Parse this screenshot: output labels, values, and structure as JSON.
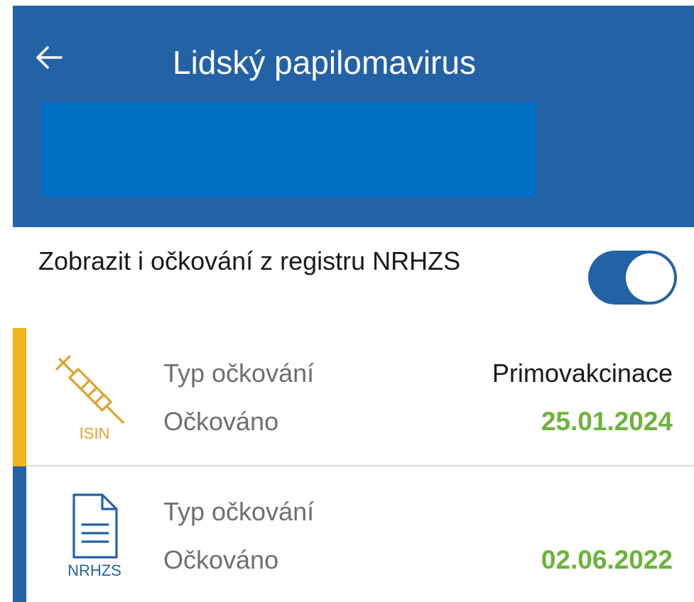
{
  "header": {
    "title": "Lidský papilomavirus",
    "back_icon": "arrow-left-icon",
    "background": "#2462a6",
    "redaction_color": "#0070c4"
  },
  "registry_toggle": {
    "label": "Zobrazit i očkování z registru NRHZS",
    "enabled": true,
    "color": "#2462a6"
  },
  "records": [
    {
      "source": "ISIN",
      "source_icon": "syringe-icon",
      "accent": "#f0b41f",
      "type_label": "Typ očkování",
      "type_value": "Primovakcinace",
      "date_label": "Očkováno",
      "date_value": "25.01.2024"
    },
    {
      "source": "NRHZS",
      "source_icon": "document-icon",
      "accent": "#2462a6",
      "type_label": "Typ očkování",
      "type_value": "",
      "date_label": "Očkováno",
      "date_value": "02.06.2022"
    }
  ],
  "colors": {
    "date": "#6cb33b"
  }
}
